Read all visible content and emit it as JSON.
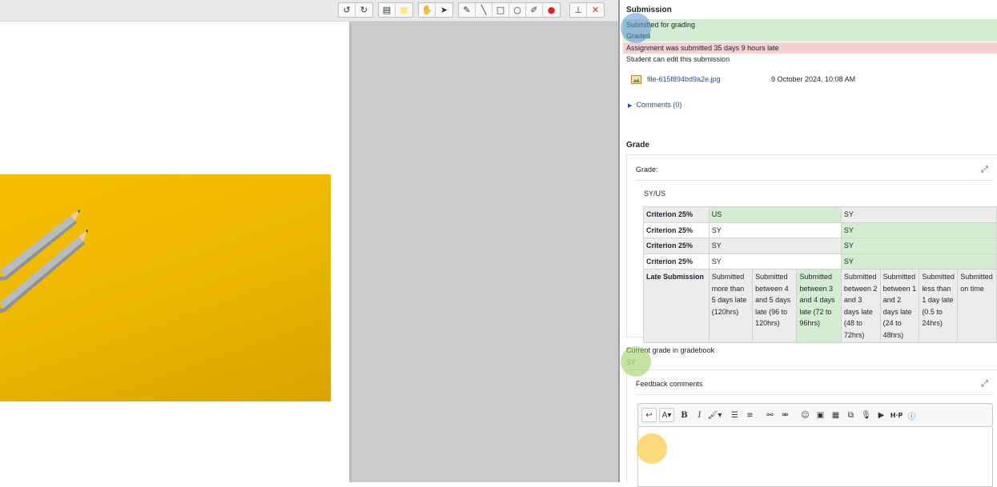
{
  "toolbar": {
    "groups": [
      {
        "tools": [
          {
            "icon": "rotate-left-icon",
            "glyph": "↺"
          },
          {
            "icon": "rotate-right-icon",
            "glyph": "↻"
          }
        ]
      },
      {
        "tools": [
          {
            "icon": "comment-icon",
            "glyph": "▤"
          },
          {
            "icon": "color-swatch-icon",
            "glyph": "■",
            "color": "#ffe680"
          }
        ]
      },
      {
        "tools": [
          {
            "icon": "hand-icon",
            "glyph": "✋"
          },
          {
            "icon": "select-arrow-icon",
            "glyph": "➤"
          }
        ]
      },
      {
        "tools": [
          {
            "icon": "pen-icon",
            "glyph": "✎"
          },
          {
            "icon": "line-icon",
            "glyph": "╲"
          },
          {
            "icon": "rectangle-icon",
            "glyph": "□"
          },
          {
            "icon": "oval-icon",
            "glyph": "○"
          },
          {
            "icon": "highlighter-icon",
            "glyph": "✐"
          },
          {
            "icon": "ink-color-icon",
            "glyph": "●",
            "color": "#e02020"
          }
        ]
      },
      {
        "tools": [
          {
            "icon": "stamp-icon",
            "glyph": "⊥"
          },
          {
            "icon": "delete-icon",
            "glyph": "✕",
            "color": "#d32f2f"
          }
        ]
      }
    ]
  },
  "submission": {
    "heading": "Submission",
    "status_grading": "Submitted for grading",
    "status_graded": "Graded",
    "late_notice": "Assignment was submitted 35 days 9 hours late",
    "edit_notice": "Student can edit this submission",
    "file_name": "file-615f894bd9a2e.jpg",
    "file_date": "9 October 2024, 10:08 AM",
    "comments_link": "Comments (0)"
  },
  "grade": {
    "heading": "Grade",
    "label": "Grade:",
    "scale": "SY/US",
    "rubric": {
      "criteria": [
        {
          "name": "Criterion 25%",
          "levels": [
            "US",
            "SY"
          ],
          "selected": 0
        },
        {
          "name": "Criterion 25%",
          "levels": [
            "SY",
            "SY"
          ],
          "selected": 1
        },
        {
          "name": "Criterion 25%",
          "levels": [
            "SY",
            "SY"
          ],
          "selected": 1
        },
        {
          "name": "Criterion 25%",
          "levels": [
            "SY",
            "SY"
          ],
          "selected": 1
        }
      ],
      "late": {
        "name": "Late Submission",
        "levels": [
          "Submitted more than 5 days late (120hrs)",
          "Submitted between 4 and 5 days late (96 to 120hrs)",
          "Submitted between 3 and 4 days late (72 to 96hrs)",
          "Submitted between 2 and 3 days late (48 to 72hrs)",
          "Submitted between 1 and 2 days late (24 to 48hrs)",
          "Submitted less than 1 day late (0.5 to 24hrs)",
          "Submitted on time"
        ],
        "selected": 2
      }
    },
    "current_label": "Current grade in gradebook",
    "current_value": "SY"
  },
  "feedback": {
    "label": "Feedback comments",
    "editor_tools": [
      {
        "icon": "undo-icon",
        "glyph": "↩",
        "boxed": true
      },
      {
        "icon": "font-size-icon",
        "glyph": "A▾",
        "boxed": true
      },
      {
        "icon": "bold-icon",
        "glyph": "B"
      },
      {
        "icon": "italic-icon",
        "glyph": "I"
      },
      {
        "icon": "paint-brush-icon",
        "glyph": "🖌▾"
      },
      {
        "icon": "bullet-list-icon",
        "glyph": "☰",
        "sep": true
      },
      {
        "icon": "numbered-list-icon",
        "glyph": "≡"
      },
      {
        "icon": "link-icon",
        "glyph": "⚯",
        "sep": true
      },
      {
        "icon": "unlink-icon",
        "glyph": "⚮"
      },
      {
        "icon": "emoji-icon",
        "glyph": "☺",
        "sep": true
      },
      {
        "icon": "image-icon",
        "glyph": "▣"
      },
      {
        "icon": "media-icon",
        "glyph": "▦"
      },
      {
        "icon": "manage-files-icon",
        "glyph": "⧉"
      },
      {
        "icon": "microphone-icon",
        "glyph": "🎙"
      },
      {
        "icon": "video-camera-icon",
        "glyph": "▶"
      },
      {
        "icon": "h5p-icon",
        "glyph": "H·P"
      },
      {
        "icon": "accessibility-checker-icon",
        "glyph": "ⓘ",
        "color": "#1e6fd9"
      }
    ]
  }
}
